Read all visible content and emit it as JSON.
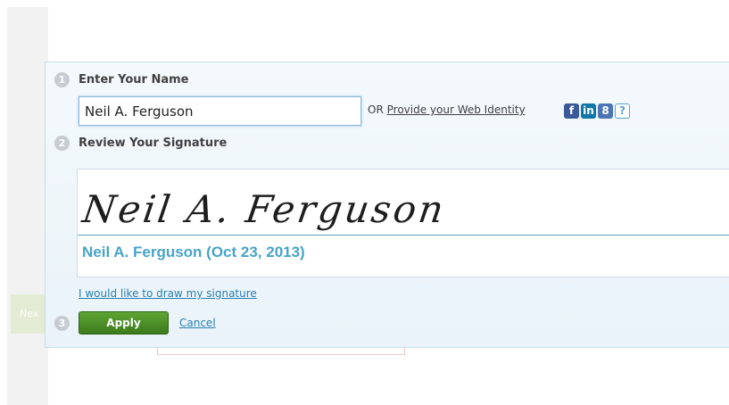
{
  "background": {
    "next_tab_label": "Nex"
  },
  "step1": {
    "number": "1",
    "title": "Enter Your Name"
  },
  "name_input": {
    "value": "Neil A. Ferguson"
  },
  "web_identity": {
    "or_text": "OR",
    "link_label": "Provide your Web Identity"
  },
  "social": [
    {
      "name": "facebook",
      "glyph": "f",
      "color": "#3b5998"
    },
    {
      "name": "linkedin",
      "glyph": "in",
      "color": "#0e76a8"
    },
    {
      "name": "google",
      "glyph": "8",
      "color": "#4d75b5"
    },
    {
      "name": "help",
      "glyph": "?",
      "color": "#5aa0d0"
    }
  ],
  "step2": {
    "number": "2",
    "title": "Review Your Signature"
  },
  "signature": {
    "script_text": "Neil A. Ferguson",
    "stamp_text": "Neil A. Ferguson (Oct 23, 2013)"
  },
  "draw_link": "I would like to draw my signature",
  "step3": {
    "number": "3"
  },
  "actions": {
    "apply_label": "Apply",
    "cancel_label": "Cancel"
  },
  "colors": {
    "accent_green": "#4a8f26",
    "link_blue": "#2a7fb0",
    "stamp_blue": "#47a3c9"
  }
}
